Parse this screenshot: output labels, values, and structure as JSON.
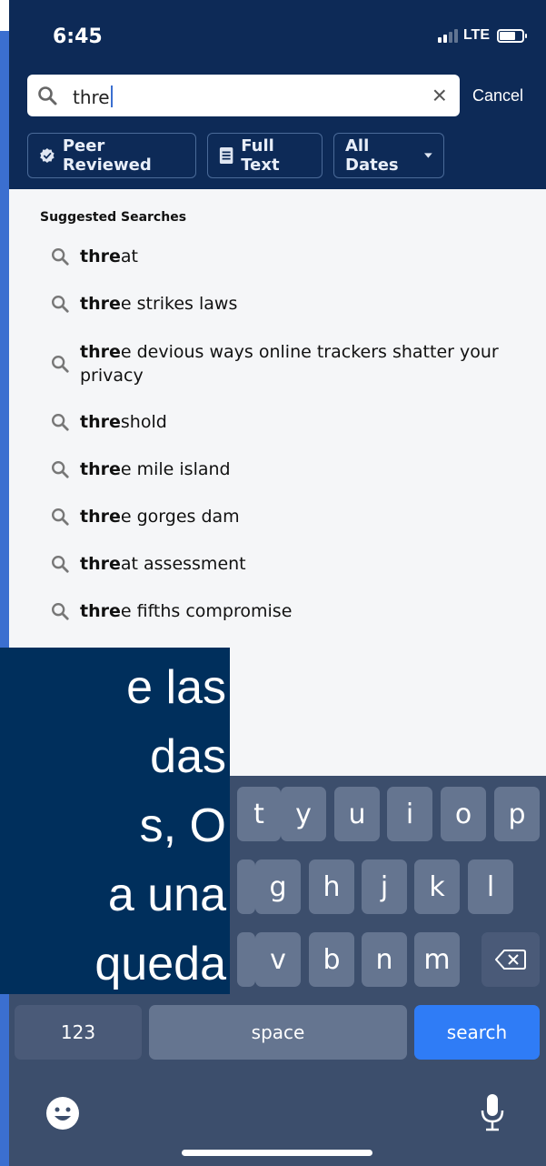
{
  "status_bar": {
    "time": "6:45",
    "network": "LTE"
  },
  "search": {
    "query": "thre",
    "cancel_label": "Cancel"
  },
  "filters": [
    {
      "label": "Peer Reviewed",
      "icon": "verified-badge-icon"
    },
    {
      "label": "Full Text",
      "icon": "document-icon"
    },
    {
      "label": "All Dates",
      "icon": "caret-down-icon"
    }
  ],
  "suggestions": {
    "title": "Suggested Searches",
    "items": [
      {
        "bold": "thre",
        "rest": "at"
      },
      {
        "bold": "thre",
        "rest": "e strikes laws"
      },
      {
        "bold": "thre",
        "rest": "e devious ways online trackers shatter your",
        "rest2": "privacy"
      },
      {
        "bold": "thre",
        "rest": "shold"
      },
      {
        "bold": "thre",
        "rest": "e mile island"
      },
      {
        "bold": "thre",
        "rest": "e gorges dam"
      },
      {
        "bold": "thre",
        "rest": "at assessment"
      },
      {
        "bold": "thre",
        "rest": "e fifths compromise"
      }
    ]
  },
  "keyboard": {
    "row1": [
      "t",
      "y",
      "u",
      "i",
      "o",
      "p"
    ],
    "row2": [
      "g",
      "h",
      "j",
      "k",
      "l"
    ],
    "row3": [
      "v",
      "b",
      "n",
      "m"
    ],
    "numbers_label": "123",
    "space_label": "space",
    "search_label": "search",
    "backspace_icon": "backspace-icon",
    "emoji_icon": "emoji-icon",
    "mic_icon": "microphone-icon"
  },
  "overlay_caption": {
    "lines": [
      "e las",
      "das",
      "s, O",
      "a una",
      "queda"
    ]
  },
  "colors": {
    "header_bg": "#0d2a57",
    "overlay_bg": "#002f5c",
    "keyboard_bg": "#3c4e6c",
    "search_key": "#2f7cf6"
  }
}
